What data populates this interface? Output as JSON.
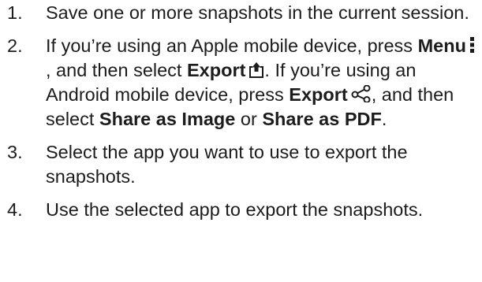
{
  "steps": [
    {
      "num": "1.",
      "text": "Save one or more snapshots in the current session."
    },
    {
      "num": "2.",
      "t1": "If you’re using an Apple mobile device, press ",
      "menu": "Menu",
      "menu_icon": "vertical-ellipsis-icon",
      "t2": ", and then select ",
      "export": "Export",
      "export_icon_apple": "share-upload-icon",
      "t3": ". If you’re using an Android mobile device, press ",
      "export2": "Export",
      "export_icon_android": "share-nodes-icon",
      "t4": ", and then select ",
      "share_image": "Share as Image",
      "t5": " or ",
      "share_pdf": "Share as PDF",
      "t6": "."
    },
    {
      "num": "3.",
      "text": "Select the app you want to use to export the snapshots."
    },
    {
      "num": "4.",
      "text": "Use the selected app to export the snapshots."
    }
  ]
}
